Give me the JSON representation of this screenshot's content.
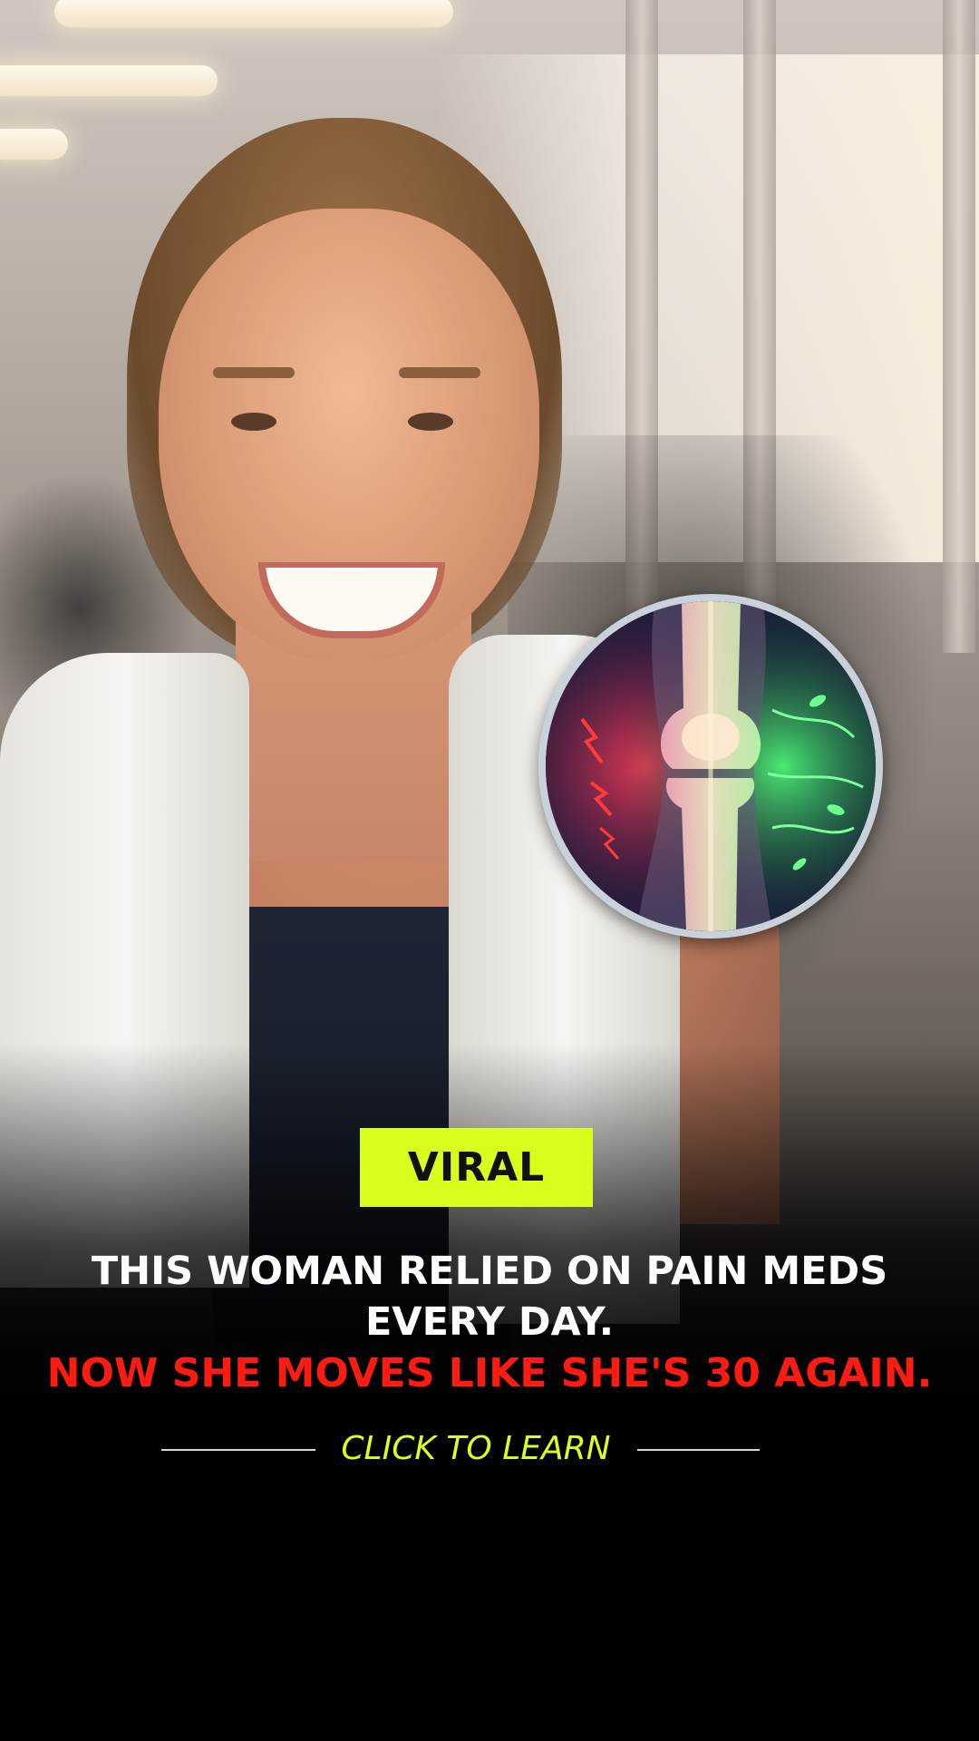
{
  "badge": {
    "label": "VIRAL",
    "color": "#d9ff1f"
  },
  "headline": {
    "line1": "THIS WOMAN RELIED ON PAIN MEDS",
    "line2": "EVERY DAY.",
    "line3": "NOW SHE MOVES LIKE SHE'S 30 AGAIN.",
    "accent_color": "#ff1a12"
  },
  "cta": {
    "label": "CLICK TO LEARN",
    "color": "#d9ff1f"
  },
  "illustration": {
    "icon": "knee-joint-icon"
  }
}
